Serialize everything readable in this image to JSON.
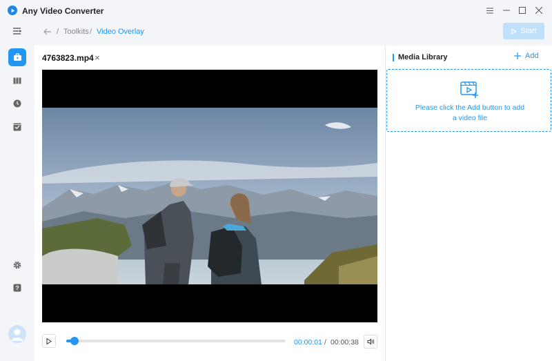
{
  "app": {
    "title": "Any Video Converter"
  },
  "breadcrumb": {
    "separator1": "/",
    "toolkits": "Toolkits",
    "separator2": "/",
    "current": "Video Overlay"
  },
  "toolbar": {
    "start_label": "Start"
  },
  "editor": {
    "file_name": "4763823.mp4",
    "close_glyph": "×",
    "time_current": "00:00:01",
    "time_separator": "/",
    "time_total": "00:00:38",
    "playback_progress": 0.026
  },
  "media_library": {
    "title": "Media Library",
    "add_label": "Add",
    "empty_text_line1": "Please click the Add button to add",
    "empty_text_line2": "a video file"
  },
  "colors": {
    "accent": "#2196f3",
    "start_disabled": "#bfe0fb",
    "background": "#f3f5f9"
  },
  "icons": {
    "sidebar": [
      "collapse-menu-icon",
      "toolbox-icon",
      "library-icon",
      "history-icon",
      "tasks-icon",
      "settings-icon",
      "help-icon"
    ],
    "controls": [
      "play-icon",
      "volume-icon"
    ]
  }
}
